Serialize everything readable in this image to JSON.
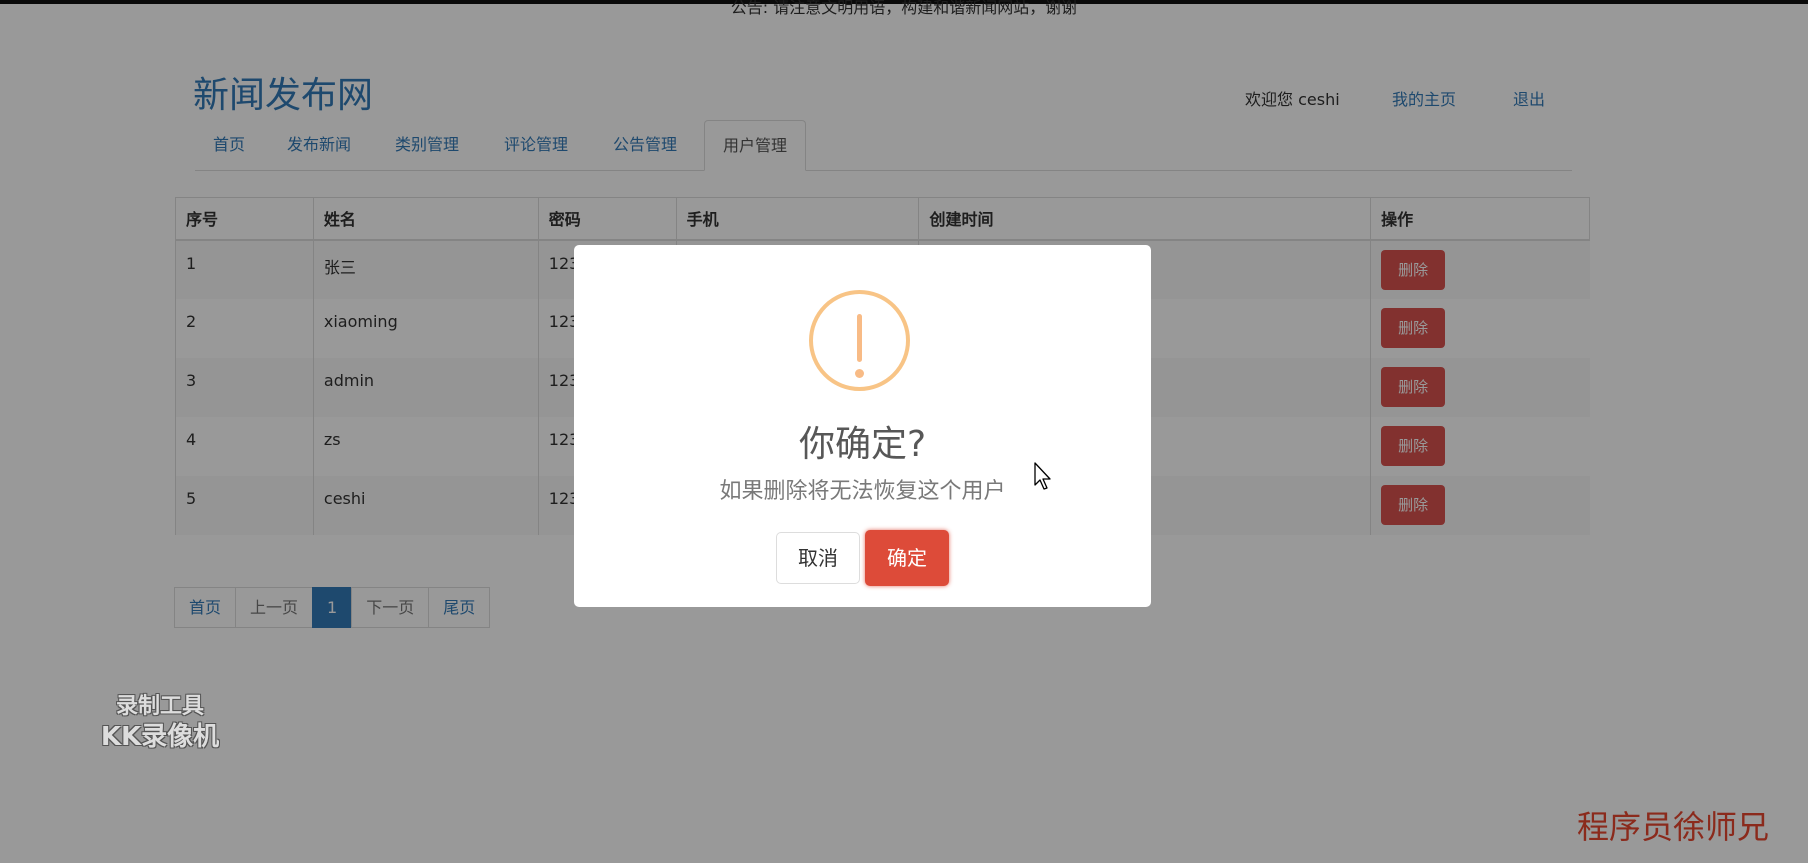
{
  "notice": "公告: 请注意文明用语，构建和谐新闻网站，谢谢",
  "site_title": "新闻发布网",
  "user": {
    "welcome": "欢迎您 ceshi",
    "home_link": "我的主页",
    "logout_link": "退出"
  },
  "nav": {
    "items": [
      {
        "label": "首页"
      },
      {
        "label": "发布新闻"
      },
      {
        "label": "类别管理"
      },
      {
        "label": "评论管理"
      },
      {
        "label": "公告管理"
      },
      {
        "label": "用户管理",
        "active": true
      }
    ]
  },
  "table": {
    "headers": [
      "序号",
      "姓名",
      "密码",
      "手机",
      "创建时间",
      "操作"
    ],
    "rows": [
      {
        "id": "1",
        "name": "张三",
        "password": "123",
        "phone": "",
        "created": "",
        "action": "删除"
      },
      {
        "id": "2",
        "name": "xiaoming",
        "password": "123",
        "phone": "",
        "created": "",
        "action": "删除"
      },
      {
        "id": "3",
        "name": "admin",
        "password": "123",
        "phone": "",
        "created": "",
        "action": "删除"
      },
      {
        "id": "4",
        "name": "zs",
        "password": "123",
        "phone": "",
        "created": "",
        "action": "删除"
      },
      {
        "id": "5",
        "name": "ceshi",
        "password": "123",
        "phone": "",
        "created": "",
        "action": "删除"
      }
    ]
  },
  "pager": {
    "first": "首页",
    "prev": "上一页",
    "current": "1",
    "next": "下一页",
    "last": "尾页"
  },
  "dialog": {
    "icon": "warning-icon",
    "title": "你确定?",
    "text": "如果删除将无法恢复这个用户",
    "cancel_label": "取消",
    "confirm_label": "确定",
    "confirm_color": "#dd4b39",
    "icon_color": "#f8bb86"
  },
  "watermarks": {
    "recorder_line1": "录制工具",
    "recorder_line2": "KK录像机",
    "author": "程序员徐师兄"
  },
  "colors": {
    "link": "#337ab7",
    "danger": "#d9534f"
  }
}
